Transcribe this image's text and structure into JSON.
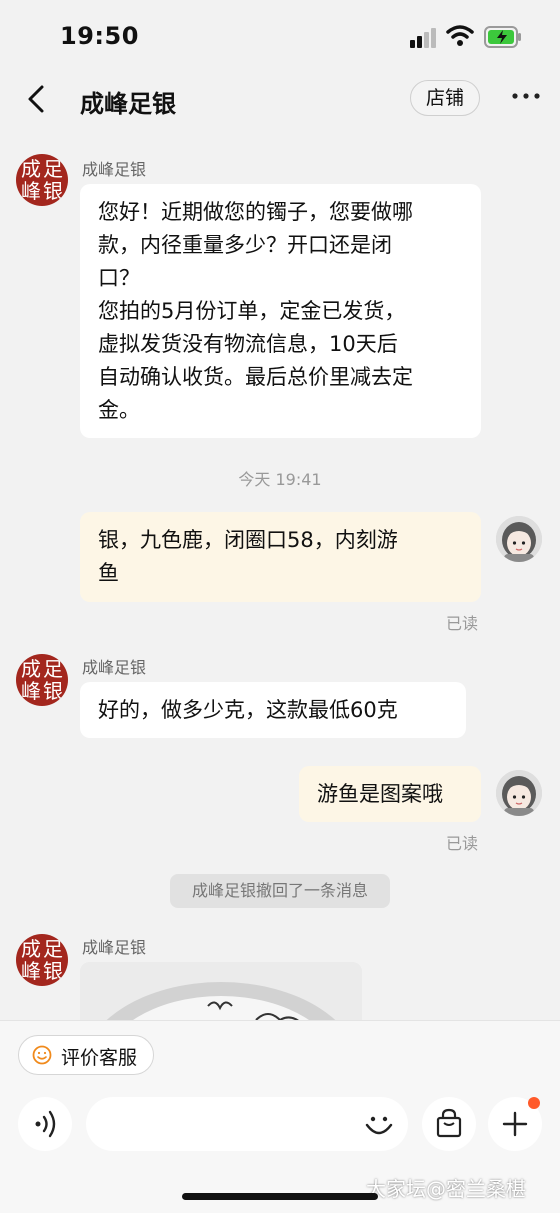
{
  "status_bar": {
    "time": "19:50",
    "icons": [
      "signal-icon",
      "wifi-icon",
      "battery-charging-icon"
    ]
  },
  "header": {
    "title": "成峰足银",
    "store_button": "店铺",
    "icons": [
      "back-icon",
      "more-icon"
    ]
  },
  "shop_avatar_chars": [
    "成",
    "足",
    "峰",
    "银"
  ],
  "messages": {
    "m1": {
      "sender": "成峰足银",
      "lines": [
        "您好！近期做您的镯子，您要做哪",
        "款，内径重量多少？开口还是闭",
        "口？",
        "您拍的5月份订单，定金已发货，",
        "虚拟发货没有物流信息，10天后",
        "自动确认收货。最后总价里减去定",
        "金。"
      ]
    },
    "timestamp": "今天 19:41",
    "m2": {
      "lines": [
        "银，九色鹿，闭圈口58，内刻游",
        "鱼"
      ],
      "read": "已读"
    },
    "m3": {
      "sender": "成峰足银",
      "text": "好的，做多少克，这款最低60克"
    },
    "m4": {
      "text": "游鱼是图案哦",
      "read": "已读"
    },
    "recall_notice": "成峰足银撤回了一条消息",
    "m5": {
      "sender": "成峰足银",
      "image": "product-photo"
    }
  },
  "bottom": {
    "eval_button": "评价客服",
    "input_placeholder": "",
    "icons": [
      "voice-icon",
      "emoji-icon",
      "shopping-bag-icon",
      "plus-icon"
    ],
    "badge_color": "#ff5a2a"
  },
  "watermark": "大家坛@密兰桑椹",
  "colors": {
    "avatar_red": "#a3271e",
    "my_bubble": "#fdf6e6",
    "background": "#f2f2f2"
  }
}
